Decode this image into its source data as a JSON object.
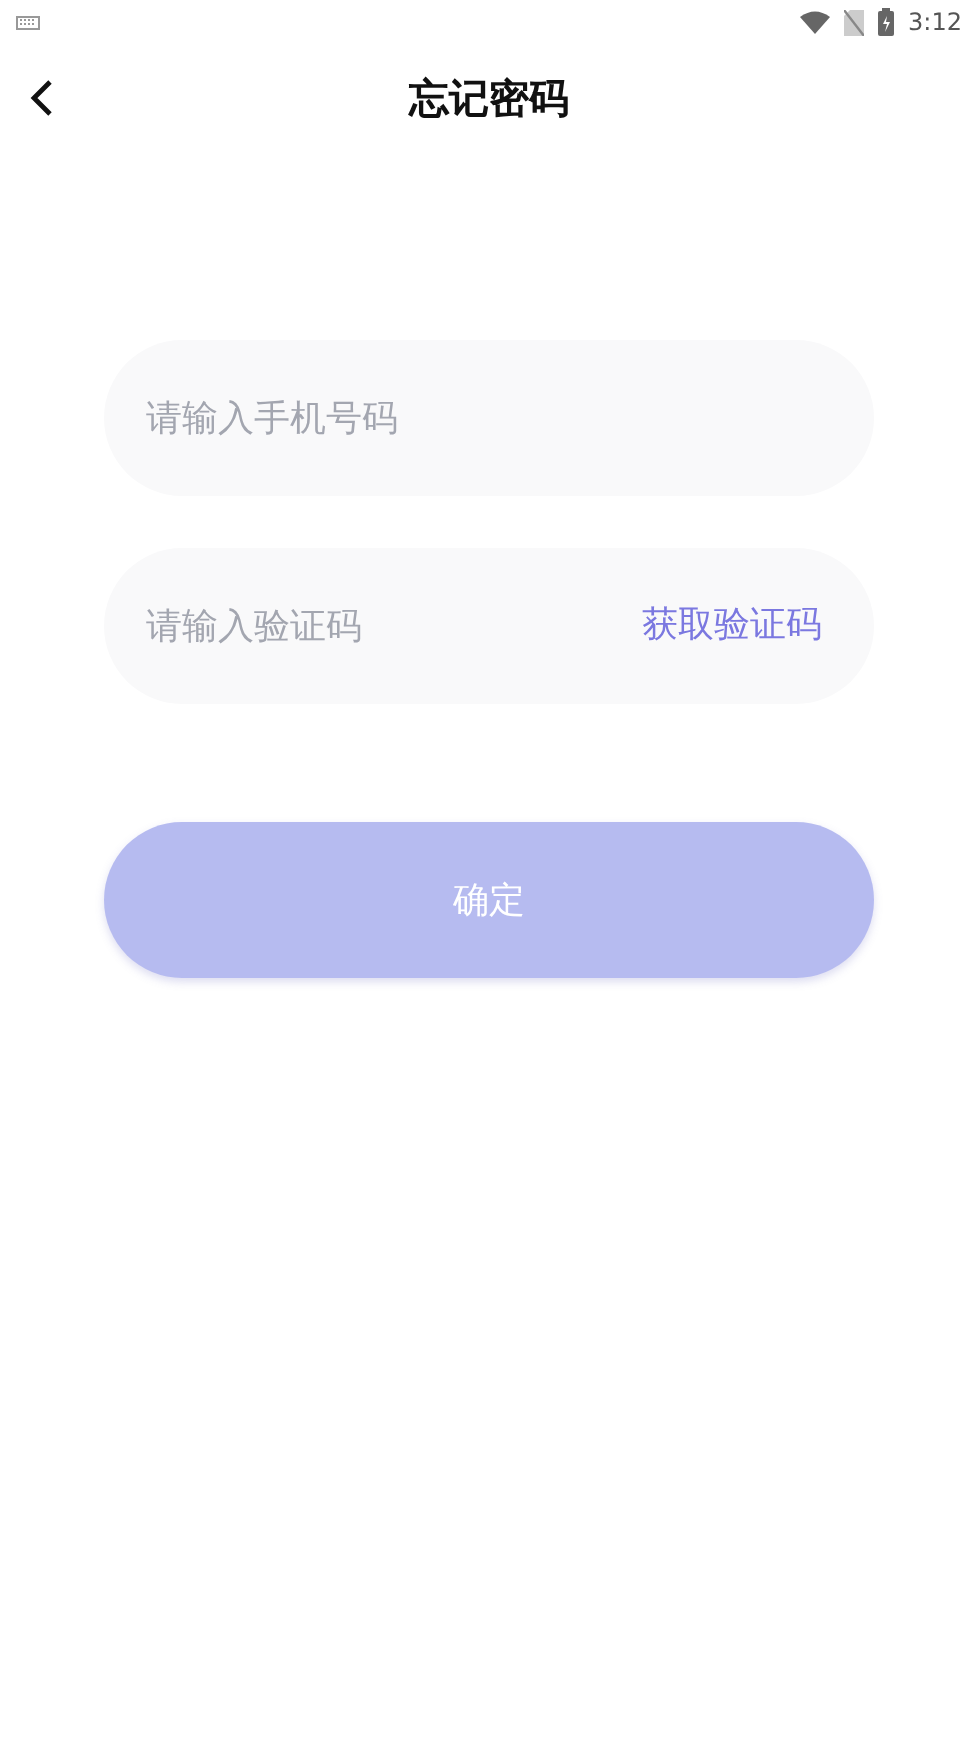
{
  "status_bar": {
    "time": "3:12"
  },
  "header": {
    "title": "忘记密码"
  },
  "form": {
    "phone_field": {
      "placeholder": "请输入手机号码"
    },
    "code_field": {
      "placeholder": "请输入验证码",
      "action": "获取验证码"
    },
    "submit_button": {
      "label": "确定",
      "disabled": true
    }
  }
}
